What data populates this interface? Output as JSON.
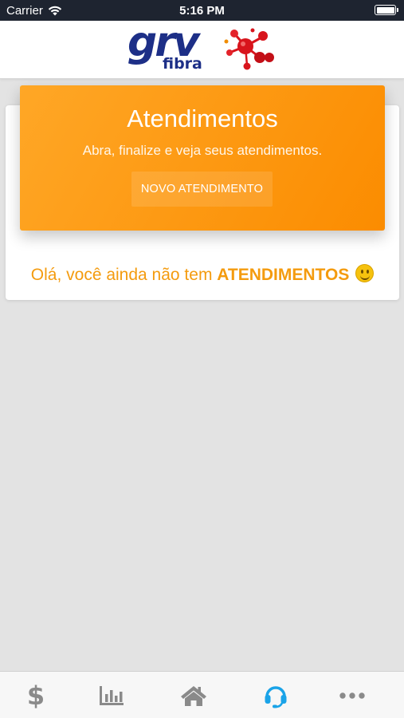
{
  "status_bar": {
    "carrier": "Carrier",
    "time": "5:16 PM",
    "icons": [
      "wifi-icon",
      "battery-icon"
    ]
  },
  "header": {
    "logo_text": "grv",
    "logo_sub": "fibra",
    "brand_colors": {
      "blue": "#1d2f87",
      "red": "#d8141c"
    }
  },
  "banner": {
    "title": "Atendimentos",
    "subtitle": "Abra, finalize e veja seus atendimentos.",
    "new_button_label": "NOVO ATENDIMENTO",
    "color": "#fb8c00"
  },
  "empty_state": {
    "prefix": "Olá, você ainda não tem ",
    "highlight": "ATENDIMENTOS",
    "emoji_icon": "smiley-icon",
    "color": "#f49b0e"
  },
  "tab_bar": {
    "items": [
      {
        "icon": "dollar-icon",
        "label": "$",
        "active": false
      },
      {
        "icon": "chart-icon",
        "active": false
      },
      {
        "icon": "home-icon",
        "active": false
      },
      {
        "icon": "headset-icon",
        "active": true
      },
      {
        "icon": "more-icon",
        "active": false
      }
    ],
    "active_color": "#1aa3e8",
    "inactive_color": "#8a8a8a"
  }
}
